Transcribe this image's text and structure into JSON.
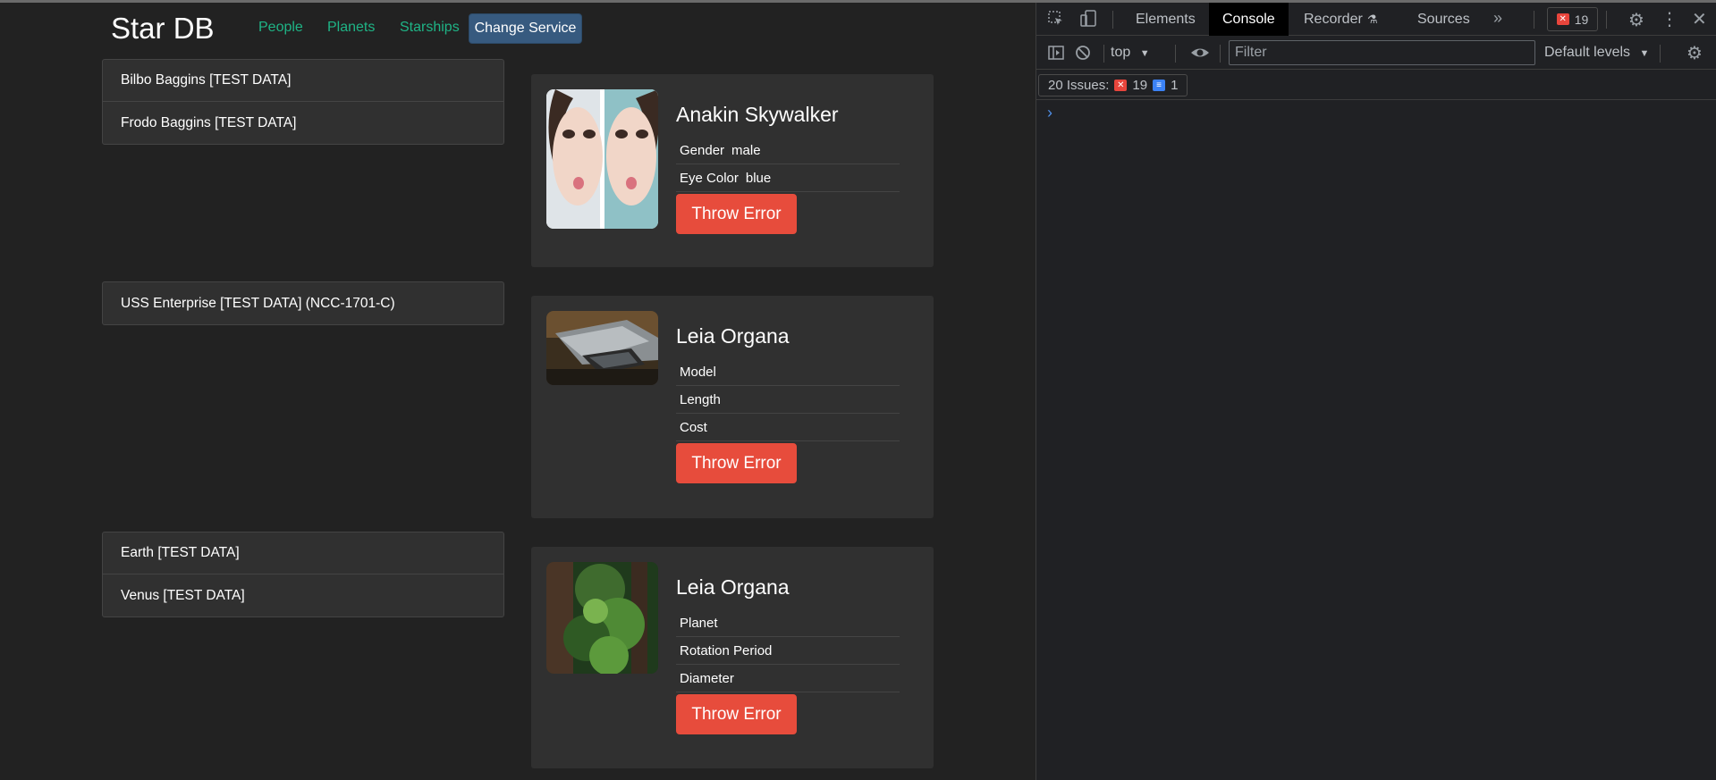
{
  "app": {
    "brand": "Star DB",
    "nav": {
      "people": "People",
      "planets": "Planets",
      "starships": "Starships",
      "change_service": "Change Service"
    },
    "sections": [
      {
        "list": [
          "Bilbo Baggins [TEST DATA]",
          "Frodo Baggins [TEST DATA]"
        ],
        "card": {
          "title": "Anakin Skywalker",
          "rows": [
            {
              "label": "Gender",
              "value": "male"
            },
            {
              "label": "Eye Color",
              "value": "blue"
            }
          ],
          "button": "Throw Error"
        }
      },
      {
        "list": [
          "USS Enterprise [TEST DATA] (NCC-1701-C)"
        ],
        "card": {
          "title": "Leia Organa",
          "rows": [
            {
              "label": "Model",
              "value": ""
            },
            {
              "label": "Length",
              "value": ""
            },
            {
              "label": "Cost",
              "value": ""
            }
          ],
          "button": "Throw Error"
        }
      },
      {
        "list": [
          "Earth [TEST DATA]",
          "Venus [TEST DATA]"
        ],
        "card": {
          "title": "Leia Organa",
          "rows": [
            {
              "label": "Planet",
              "value": ""
            },
            {
              "label": "Rotation Period",
              "value": ""
            },
            {
              "label": "Diameter",
              "value": ""
            }
          ],
          "button": "Throw Error"
        }
      }
    ],
    "colors": {
      "accent_link": "#1fb486",
      "primary_button": "#375a7f",
      "danger_button": "#e74c3c",
      "background": "#222222",
      "card": "#303030"
    }
  },
  "devtools": {
    "tabs": [
      "Elements",
      "Console",
      "Recorder",
      "Sources"
    ],
    "active_tab": "Console",
    "error_count": "19",
    "context": "top",
    "filter_placeholder": "Filter",
    "levels": "Default levels",
    "issues_label": "20 Issues:",
    "issues_errors": "19",
    "issues_info": "1",
    "icons": [
      "inspect-icon",
      "device-toggle-icon",
      "more-tabs-icon",
      "settings-icon",
      "kebab-menu-icon",
      "close-icon",
      "sidebar-toggle-icon",
      "clear-console-icon",
      "eye-icon",
      "console-settings-icon",
      "prompt-chevron-icon"
    ]
  }
}
